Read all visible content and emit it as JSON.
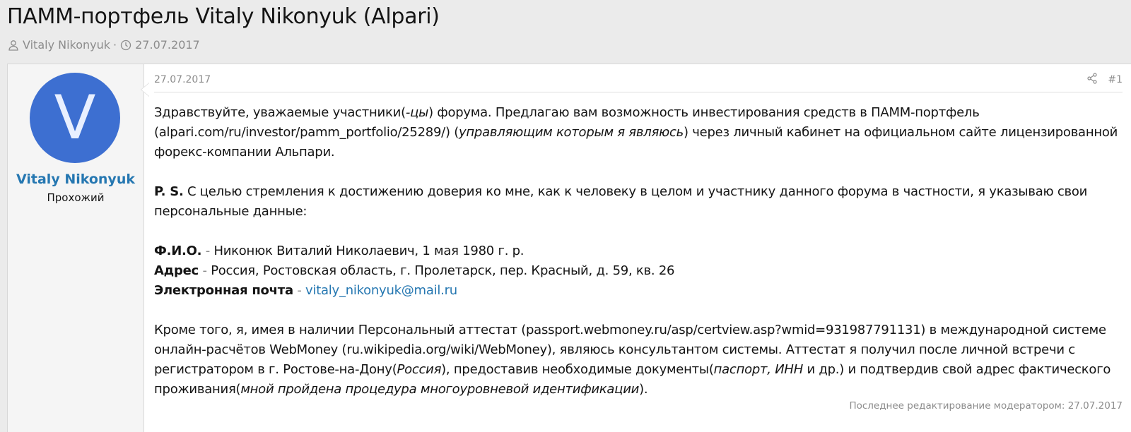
{
  "thread": {
    "title": "ПАММ-портфель Vitaly Nikonyuk (Alpari)",
    "author": "Vitaly Nikonyuk",
    "separator": "·",
    "date": "27.07.2017"
  },
  "icons": {
    "user": "user-icon",
    "clock": "clock-icon",
    "share": "share-icon"
  },
  "colors": {
    "avatar_bg": "#3d6fd1",
    "link": "#2577b1",
    "muted": "#8c8c8c"
  },
  "post": {
    "avatar_letter": "V",
    "username": "Vitaly Nikonyuk",
    "user_title": "Прохожий",
    "date": "27.07.2017",
    "number": "#1",
    "p1": {
      "a": "Здравствуйте, уважаемые участники(",
      "b": "-цы",
      "c": ") форума. Предлагаю вам возможность инвестирования средств в ПАММ-портфель (alpari.com/ru/investor/pamm_portfolio/25289/) (",
      "d": "управляющим которым я являюсь",
      "e": ") через личный кабинет на официальном сайте лицензированной форекс-компании Альпари."
    },
    "p2": {
      "bold": "P. S.",
      "text": " С целью стремления к достижению доверия ко мне, как к человеку в целом и участнику данного форума в частности, я указываю свои персональные данные:"
    },
    "p3": {
      "fio_label": "Ф.И.О.",
      "dash1": " - ",
      "fio_value": "Никонюк Виталий Николаевич, 1 мая 1980 г. р.",
      "addr_label": "Адрес",
      "dash2": " - ",
      "addr_value": "Россия, Ростовская область, г. Пролетарск, пер. Красный, д. 59, кв. 26",
      "email_label": "Электронная почта",
      "dash3": " - ",
      "email_value": "vitaly_nikonyuk@mail.ru"
    },
    "p4": {
      "a": "Кроме того, я, имея в наличии Персональный аттестат (passport.webmoney.ru/asp/certview.asp?wmid=931987791131) в международной системе онлайн-расчётов WebMoney (ru.wikipedia.org/wiki/WebMoney), являюсь консультантом системы. Аттестат я получил после личной встречи с регистратором в г. Ростове-на-Дону(",
      "b": "Россия",
      "c": "), предоставив необходимые документы(",
      "d": "паспорт, ИНН",
      "e": " и др.) и подтвердив свой адрес фактического проживания(",
      "f": "мной пройдена процедура многоуровневой идентификации",
      "g": ")."
    },
    "edited": "Последнее редактирование модератором: 27.07.2017"
  }
}
